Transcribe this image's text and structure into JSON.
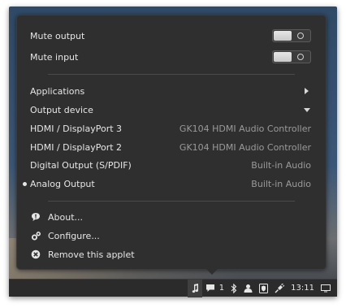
{
  "sound_applet": {
    "toggles": [
      {
        "label": "Mute output",
        "state": "off"
      },
      {
        "label": "Mute input",
        "state": "off"
      }
    ],
    "applications": {
      "label": "Applications"
    },
    "output_device": {
      "label": "Output device"
    },
    "devices": [
      {
        "name": "HDMI / DisplayPort 3",
        "detail": "GK104 HDMI Audio Controller",
        "selected": false
      },
      {
        "name": "HDMI / DisplayPort 2",
        "detail": "GK104 HDMI Audio Controller",
        "selected": false
      },
      {
        "name": "Digital Output (S/PDIF)",
        "detail": "Built-in Audio",
        "selected": false
      },
      {
        "name": "Analog Output",
        "detail": "Built-in Audio",
        "selected": true
      }
    ],
    "actions": [
      {
        "label": "About...",
        "icon": "speech-bubble-icon"
      },
      {
        "label": "Configure...",
        "icon": "gears-icon"
      },
      {
        "label": "Remove this applet",
        "icon": "close-circle-icon"
      }
    ]
  },
  "taskbar": {
    "notification_count": "1",
    "clock": "13:11"
  }
}
